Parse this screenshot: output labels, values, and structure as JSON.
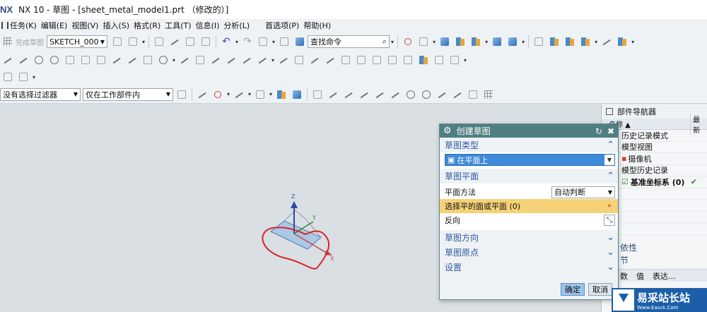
{
  "titlebar": {
    "logo": "NX",
    "title": "NX 10 - 草图 - [sheet_metal_model1.prt （修改的）]"
  },
  "menu": {
    "items": [
      "任务(K)",
      "编辑(E)",
      "视图(V)",
      "插入(S)",
      "格式(R)",
      "工具(T)",
      "信息(I)",
      "分析(L)",
      "首选项(P)",
      "帮助(H)"
    ]
  },
  "toolbar1": {
    "finish_sketch": "完成草图",
    "sketch_name": "SKETCH_000",
    "search_placeholder": "查找命令"
  },
  "toolbar4": {
    "selection_filter": "没有选择过滤器",
    "scope": "仅在工作部件内"
  },
  "navigator": {
    "title": "部件导航器",
    "col_name": "名称",
    "col_latest": "最新",
    "rows": [
      "历史记录模式",
      "模型视图",
      "摄像机",
      "模型历史记录",
      "基准坐标系 (0)"
    ],
    "check": "✔",
    "section_dependency": "依性",
    "section_details": "节",
    "props": [
      "数",
      "值",
      "表达..."
    ]
  },
  "dialog": {
    "title": "创建草图",
    "sec_type": "草图类型",
    "type_value": "在平面上",
    "sec_plane": "草图平面",
    "plane_method_label": "平面方法",
    "plane_method_value": "自动判断",
    "select_plane": "选择平的面或平面 (0)",
    "reverse": "反向",
    "sec_direction": "草图方向",
    "sec_origin": "草图原点",
    "sec_settings": "设置",
    "ok": "确定",
    "cancel": "取消"
  },
  "watermark": {
    "text": "易采站长站",
    "subtext": "Www.Easck.Com"
  },
  "axes": {
    "x": "X",
    "y": "Y",
    "z": "Z"
  },
  "colors": {
    "dialog_title_bg": "#4f7f81",
    "highlight": "#f5d277",
    "select_blue": "#3f89d9",
    "annotation_red": "#d8242a"
  }
}
